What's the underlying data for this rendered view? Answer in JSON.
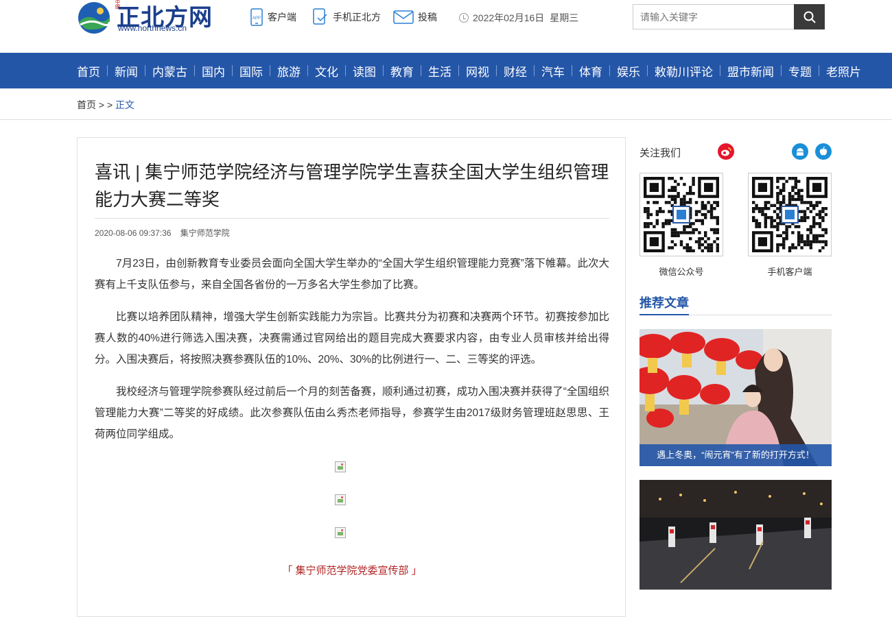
{
  "header": {
    "logo_text": "正北方网",
    "logo_tag": "中國",
    "logo_url": "www.northnews.cn",
    "links": [
      {
        "label": "客户端",
        "icon": "app-phone-icon"
      },
      {
        "label": "手机正北方",
        "icon": "mobile-icon"
      },
      {
        "label": "投稿",
        "icon": "mail-icon"
      }
    ],
    "date": "2022年02月16日",
    "weekday": "星期三",
    "search_placeholder": "请输入关键字"
  },
  "nav": [
    "首页",
    "新闻",
    "内蒙古",
    "国内",
    "国际",
    "旅游",
    "文化",
    "读图",
    "教育",
    "生活",
    "网视",
    "财经",
    "汽车",
    "体育",
    "娱乐",
    "敕勒川评论",
    "盟市新闻",
    "专题",
    "老照片"
  ],
  "breadcrumb": {
    "home": "首页",
    "sep": " > > ",
    "current": "正文"
  },
  "article": {
    "title": "喜讯 | 集宁师范学院经济与管理学院学生喜获全国大学生组织管理能力大赛二等奖",
    "datetime": "2020-08-06 09:37:36",
    "source": "集宁师范学院",
    "paragraphs": [
      "7月23日，由创新教育专业委员会面向全国大学生举办的“全国大学生组织管理能力竞赛”落下帷幕。此次大赛有上千支队伍参与，来自全国各省份的一万多名大学生参加了比赛。",
      "比赛以培养团队精神，增强大学生创新实践能力为宗旨。比赛共分为初赛和决赛两个环节。初赛按参加比赛人数的40%进行筛选入围决赛，决赛需通过官网给出的题目完成大赛要求内容，由专业人员审核并给出得分。入围决赛后，将按照决赛参赛队伍的10%、20%、30%的比例进行一、二、三等奖的评选。",
      "我校经济与管理学院参赛队经过前后一个月的刻苦备赛，顺利通过初赛，成功入围决赛并获得了“全国组织管理能力大赛”二等奖的好成绩。此次参赛队伍由么秀杰老师指导，参赛学生由2017级财务管理班赵思思、王荷两位同学组成。"
    ],
    "caption": "「 集宁师范学院党委宣传部 」"
  },
  "sidebar": {
    "follow_label": "关注我们",
    "qr_codes": [
      {
        "label": "微信公众号"
      },
      {
        "label": "手机客户端"
      }
    ],
    "recommend_title": "推荐文章",
    "cards": [
      {
        "caption": "遇上冬奥，“闹元宵”有了新的打开方式！"
      }
    ]
  },
  "colors": {
    "brand": "#2456a8",
    "caption": "#b22222",
    "weibo": "#e6162d",
    "app": "#1a8fd8"
  }
}
